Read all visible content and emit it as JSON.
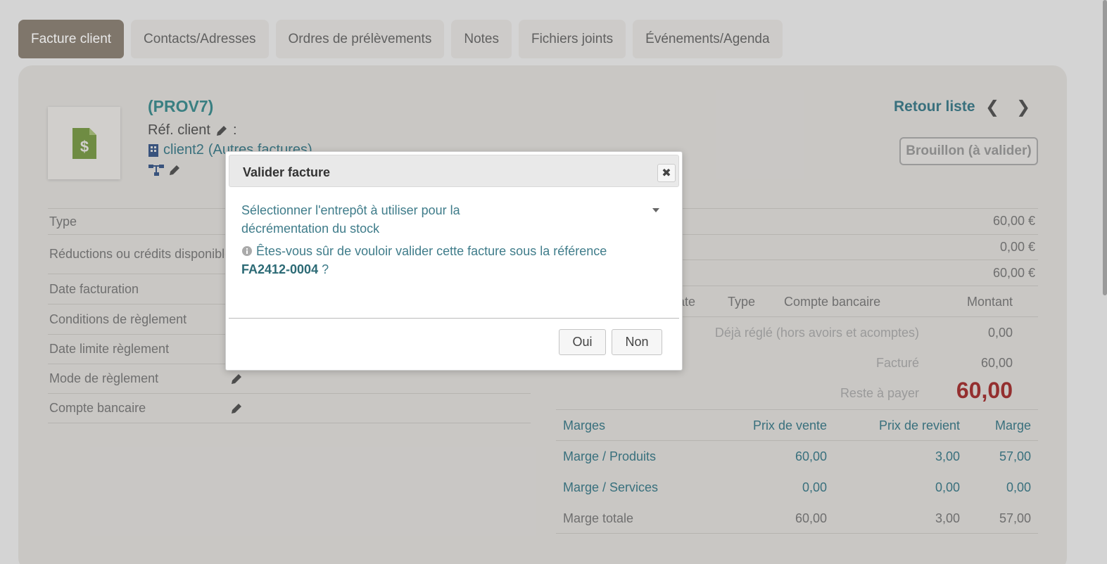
{
  "tabs": [
    {
      "label": "Facture client",
      "active": true
    },
    {
      "label": "Contacts/Adresses"
    },
    {
      "label": "Ordres de prélèvements"
    },
    {
      "label": "Notes"
    },
    {
      "label": "Fichiers joints"
    },
    {
      "label": "Événements/Agenda"
    }
  ],
  "header": {
    "ref": "(PROV7)",
    "ref_client_label": "Réf. client",
    "ref_client_suffix": ":",
    "client_name": "client2",
    "client_other": "(Autres factures)",
    "retour": "Retour liste",
    "status": "Brouillon (à valider)"
  },
  "fields": [
    {
      "label": "Type"
    },
    {
      "label": "Réductions ou crédits disponibles"
    },
    {
      "label": "Date facturation"
    },
    {
      "label": "Conditions de règlement"
    },
    {
      "label": "Date limite règlement"
    },
    {
      "label": "Mode de règlement"
    },
    {
      "label": "Compte bancaire"
    }
  ],
  "amounts": [
    "60,00 €",
    "0,00 €",
    "60,00 €"
  ],
  "payments": {
    "headers": {
      "date": "Date",
      "type": "Type",
      "account": "Compte bancaire",
      "amount": "Montant"
    },
    "deja_regle_label": "Déjà réglé (hors avoirs et acomptes)",
    "deja_regle_value": "0,00",
    "facture_label": "Facturé",
    "facture_value": "60,00",
    "reste_label": "Reste à payer",
    "reste_value": "60,00"
  },
  "marges": {
    "headers": [
      "Marges",
      "Prix de vente",
      "Prix de revient",
      "Marge"
    ],
    "rows": [
      [
        "Marge / Produits",
        "60,00",
        "3,00",
        "57,00"
      ],
      [
        "Marge / Services",
        "0,00",
        "0,00",
        "0,00"
      ],
      [
        "Marge totale",
        "60,00",
        "3,00",
        "57,00"
      ]
    ]
  },
  "dialog": {
    "title": "Valider facture",
    "close": "✖",
    "select_text": "Sélectionner l'entrepôt à utiliser pour la décrémentation du stock",
    "question": "Êtes-vous sûr de vouloir valider cette facture sous la référence",
    "reference": "FA2412-0004",
    "question_end": "?",
    "yes": "Oui",
    "no": "Non"
  },
  "colors": {
    "accent": "#3f7c8a",
    "active_tab": "#8c8276",
    "reste": "#a33434",
    "icon_green": "#7a9a4a"
  }
}
